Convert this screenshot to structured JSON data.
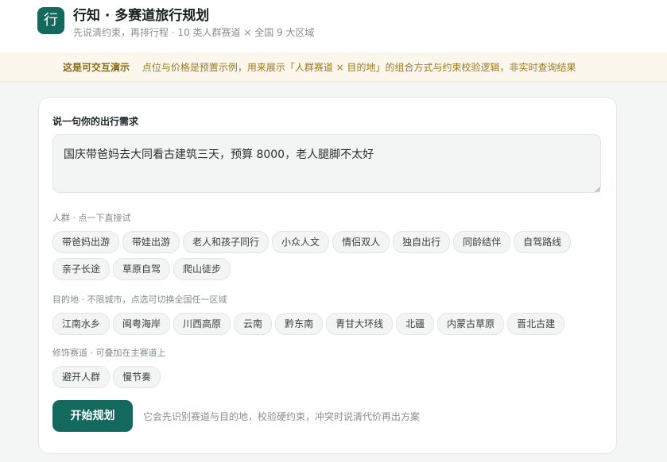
{
  "app": {
    "logo_char": "行",
    "title": "行知 · 多赛道旅行规划",
    "subtitle": "先说清约束，再排行程 · 10 类人群赛道 × 全国 9 大区域"
  },
  "notice": {
    "strong": "这是可交互演示",
    "text": "点位与价格是预置示例，用来展示「人群赛道 × 目的地」的组合方式与约束校验逻辑，非实时查询结果"
  },
  "form": {
    "label": "说一句你的出行需求",
    "input_value": "国庆带爸妈去大同看古建筑三天，预算 8000，老人腿脚不太好"
  },
  "crowd": {
    "title": "人群 · 点一下直接试",
    "chips": [
      "带爸妈出游",
      "带娃出游",
      "老人和孩子同行",
      "小众人文",
      "情侣双人",
      "独自出行",
      "同龄结伴",
      "自驾路线",
      "亲子长途",
      "草原自驾",
      "爬山徒步"
    ]
  },
  "destination": {
    "title": "目的地 · 不限城市，点选可切换全国任一区域",
    "chips": [
      "江南水乡",
      "闽粤海岸",
      "川西高原",
      "云南",
      "黔东南",
      "青甘大环线",
      "北疆",
      "内蒙古草原",
      "晋北古建"
    ]
  },
  "modifier": {
    "title": "修饰赛道 · 可叠加在主赛道上",
    "chips": [
      "避开人群",
      "慢节奏"
    ]
  },
  "actions": {
    "start_label": "开始规划",
    "hint": "它会先识别赛道与目的地，校验硬约束，冲突时说清代价再出方案"
  }
}
